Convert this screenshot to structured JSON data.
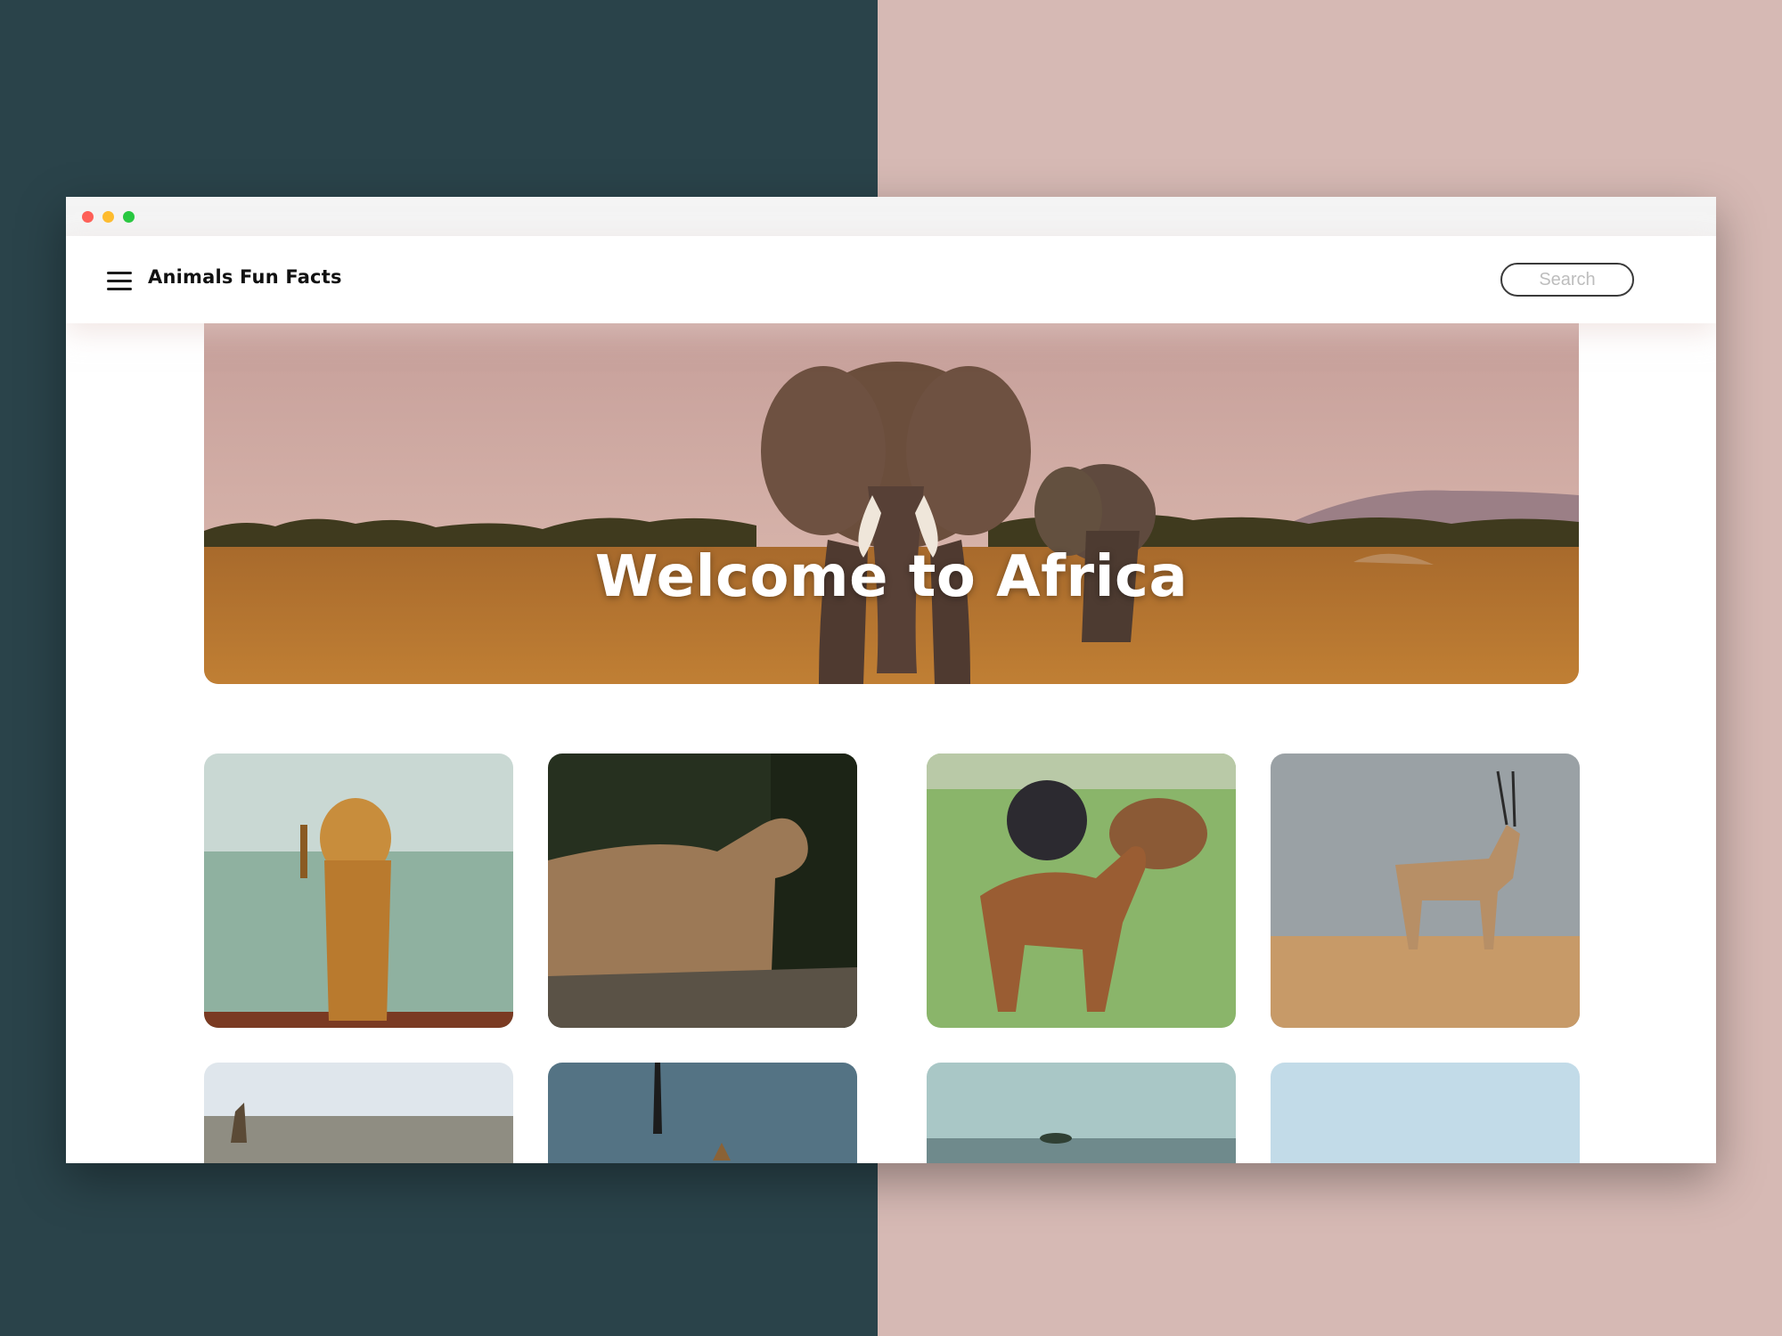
{
  "background": {
    "left_color": "#2a434a",
    "right_color": "#d6b9b4"
  },
  "window": {
    "controls": [
      "close-dot",
      "minimize-dot",
      "maximize-dot"
    ],
    "control_colors": [
      "#fe5f57",
      "#febc2e",
      "#28c840"
    ]
  },
  "navbar": {
    "menu_icon": "hamburger-menu-icon",
    "brand": "Animals Fun Facts",
    "search_placeholder": "Search"
  },
  "hero": {
    "title": "Welcome to Africa",
    "image": "elephants-savanna"
  },
  "gallery": {
    "rows": [
      [
        "lioness",
        "cougar",
        "nyala-antelopes",
        "oryx"
      ],
      [
        "giraffe-plains",
        "acacia-tree-giraffes",
        "savanna-acacia",
        "sky-landscape"
      ]
    ]
  }
}
